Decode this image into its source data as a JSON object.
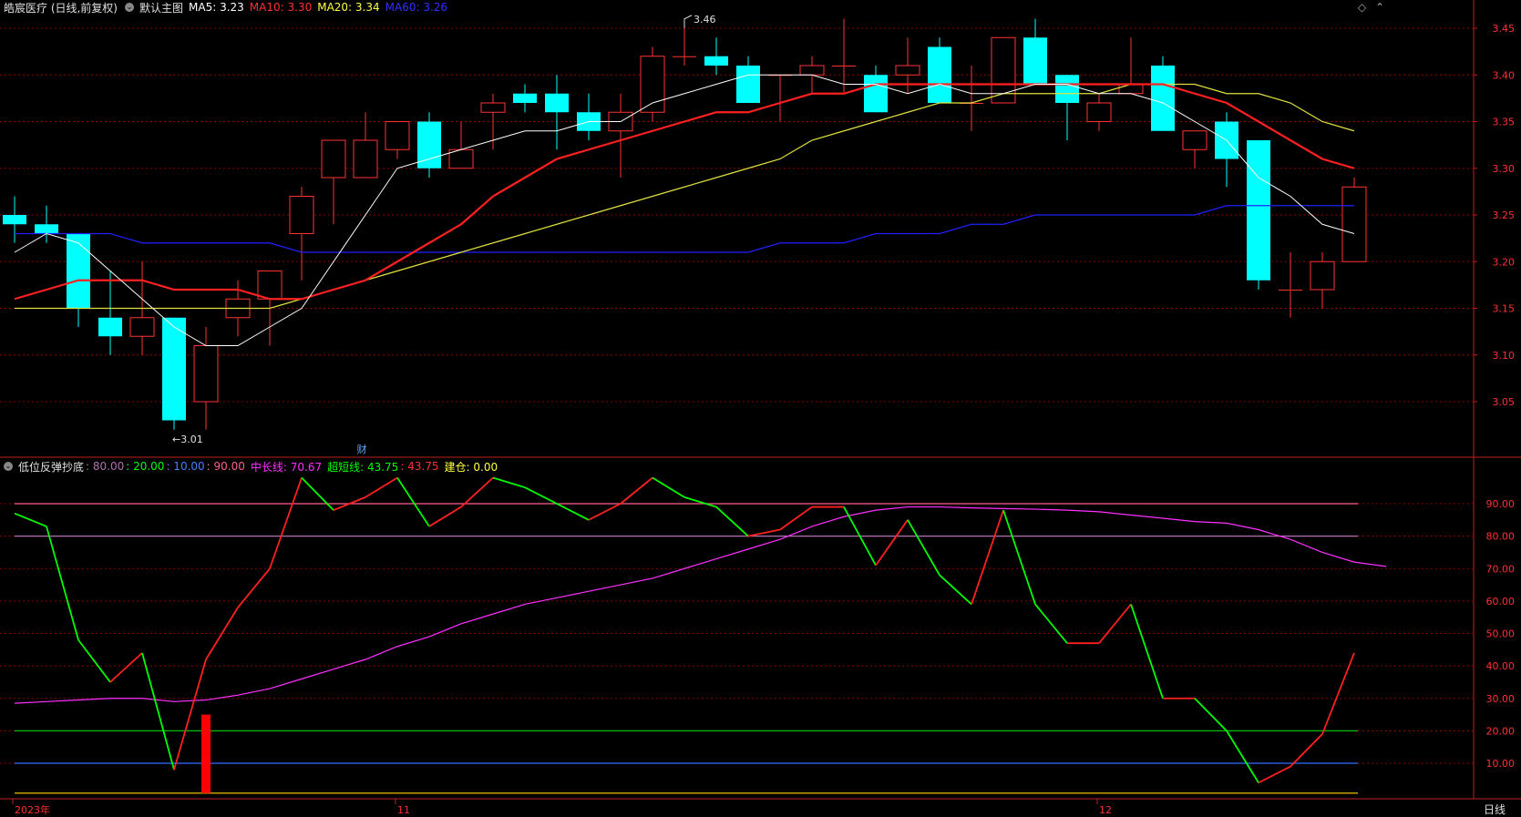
{
  "header_main": {
    "stock": "皓宸医疗 (日线,前复权)",
    "template": "默认主图",
    "ma5": "MA5: 3.23",
    "ma10": "MA10: 3.30",
    "ma20": "MA20: 3.34",
    "ma60": "MA60: 3.26"
  },
  "header_ind": {
    "name": "低位反弹抄底",
    "v80": ": 80.00",
    "v20": ": 20.00",
    "v10": ": 10.00",
    "v90": ": 90.00",
    "mid": "中长线: 70.67",
    "ultra": "超短线: 43.75",
    "ultra2": ": 43.75",
    "build": "建仓: 0.00"
  },
  "colors": {
    "up": "#ff3232",
    "down": "#00ffff",
    "ma5": "#ffffff",
    "ma10": "#ff2020",
    "ma20": "#e0e040",
    "ma60": "#2020ff",
    "grid": "#8b0000",
    "axis": "#c02020",
    "midline": "#ff30ff",
    "ultra_up": "#ff2020",
    "ultra_down": "#00ff00",
    "line90": "#ff6090",
    "line80": "#b070b0",
    "line20": "#00c000",
    "line10": "#3070ff",
    "build": "#c0a000"
  },
  "annotations": {
    "high_label": "3.46",
    "low_label": "←3.01",
    "cai": "财",
    "period": "日线"
  },
  "xaxis": {
    "labels": [
      "2023年",
      "11",
      "12"
    ],
    "label_index": [
      0,
      12,
      34
    ]
  },
  "chart_data": [
    {
      "type": "candlestick",
      "ylim": [
        3.0,
        3.47
      ],
      "yticks": [
        "3.45",
        "3.40",
        "3.35",
        "3.30",
        "3.25",
        "3.20",
        "3.15",
        "3.10",
        "3.05"
      ],
      "candles": [
        [
          3.25,
          3.27,
          3.22,
          3.24
        ],
        [
          3.24,
          3.26,
          3.22,
          3.23
        ],
        [
          3.23,
          3.23,
          3.13,
          3.15
        ],
        [
          3.14,
          3.19,
          3.1,
          3.12
        ],
        [
          3.12,
          3.2,
          3.1,
          3.14
        ],
        [
          3.14,
          3.14,
          3.02,
          3.03
        ],
        [
          3.05,
          3.13,
          3.02,
          3.11
        ],
        [
          3.14,
          3.18,
          3.12,
          3.16
        ],
        [
          3.16,
          3.19,
          3.11,
          3.19
        ],
        [
          3.23,
          3.28,
          3.18,
          3.27
        ],
        [
          3.29,
          3.29,
          3.24,
          3.33
        ],
        [
          3.29,
          3.36,
          3.29,
          3.33
        ],
        [
          3.32,
          3.35,
          3.31,
          3.35
        ],
        [
          3.35,
          3.36,
          3.29,
          3.3
        ],
        [
          3.3,
          3.35,
          3.3,
          3.32
        ],
        [
          3.36,
          3.38,
          3.32,
          3.37
        ],
        [
          3.38,
          3.39,
          3.36,
          3.37
        ],
        [
          3.38,
          3.4,
          3.32,
          3.36
        ],
        [
          3.36,
          3.38,
          3.33,
          3.34
        ],
        [
          3.34,
          3.38,
          3.29,
          3.36
        ],
        [
          3.36,
          3.43,
          3.35,
          3.42
        ],
        [
          3.42,
          3.46,
          3.41,
          3.42
        ],
        [
          3.42,
          3.44,
          3.4,
          3.41
        ],
        [
          3.41,
          3.42,
          3.37,
          3.37
        ],
        [
          3.4,
          3.4,
          3.35,
          3.4
        ],
        [
          3.4,
          3.42,
          3.38,
          3.41
        ],
        [
          3.41,
          3.46,
          3.38,
          3.41
        ],
        [
          3.4,
          3.41,
          3.36,
          3.36
        ],
        [
          3.4,
          3.44,
          3.38,
          3.41
        ],
        [
          3.43,
          3.44,
          3.37,
          3.37
        ],
        [
          3.37,
          3.41,
          3.34,
          3.37
        ],
        [
          3.37,
          3.44,
          3.37,
          3.44
        ],
        [
          3.44,
          3.46,
          3.39,
          3.39
        ],
        [
          3.4,
          3.4,
          3.33,
          3.37
        ],
        [
          3.35,
          3.38,
          3.34,
          3.37
        ],
        [
          3.38,
          3.44,
          3.38,
          3.39
        ],
        [
          3.41,
          3.42,
          3.34,
          3.34
        ],
        [
          3.32,
          3.34,
          3.3,
          3.34
        ],
        [
          3.35,
          3.36,
          3.28,
          3.31
        ],
        [
          3.33,
          3.33,
          3.17,
          3.18
        ],
        [
          3.17,
          3.21,
          3.14,
          3.17
        ],
        [
          3.17,
          3.21,
          3.15,
          3.2
        ],
        [
          3.2,
          3.29,
          3.2,
          3.28
        ]
      ],
      "ma5": [
        3.21,
        3.23,
        3.22,
        3.19,
        3.16,
        3.13,
        3.11,
        3.11,
        3.13,
        3.15,
        3.2,
        3.25,
        3.3,
        3.31,
        3.32,
        3.33,
        3.34,
        3.34,
        3.35,
        3.35,
        3.37,
        3.38,
        3.39,
        3.4,
        3.4,
        3.4,
        3.39,
        3.39,
        3.38,
        3.39,
        3.38,
        3.38,
        3.39,
        3.39,
        3.38,
        3.38,
        3.37,
        3.35,
        3.33,
        3.29,
        3.27,
        3.24,
        3.23
      ],
      "ma10": [
        3.16,
        3.17,
        3.18,
        3.18,
        3.18,
        3.17,
        3.17,
        3.17,
        3.16,
        3.16,
        3.17,
        3.18,
        3.2,
        3.22,
        3.24,
        3.27,
        3.29,
        3.31,
        3.32,
        3.33,
        3.34,
        3.35,
        3.36,
        3.36,
        3.37,
        3.38,
        3.38,
        3.39,
        3.39,
        3.39,
        3.39,
        3.39,
        3.39,
        3.39,
        3.39,
        3.39,
        3.39,
        3.38,
        3.37,
        3.35,
        3.33,
        3.31,
        3.3
      ],
      "ma20": [
        3.15,
        3.15,
        3.15,
        3.15,
        3.15,
        3.15,
        3.15,
        3.15,
        3.15,
        3.16,
        3.17,
        3.18,
        3.19,
        3.2,
        3.21,
        3.22,
        3.23,
        3.24,
        3.25,
        3.26,
        3.27,
        3.28,
        3.29,
        3.3,
        3.31,
        3.33,
        3.34,
        3.35,
        3.36,
        3.37,
        3.37,
        3.38,
        3.38,
        3.38,
        3.38,
        3.39,
        3.39,
        3.39,
        3.38,
        3.38,
        3.37,
        3.35,
        3.34
      ],
      "ma60": [
        3.23,
        3.23,
        3.23,
        3.23,
        3.22,
        3.22,
        3.22,
        3.22,
        3.22,
        3.21,
        3.21,
        3.21,
        3.21,
        3.21,
        3.21,
        3.21,
        3.21,
        3.21,
        3.21,
        3.21,
        3.21,
        3.21,
        3.21,
        3.21,
        3.22,
        3.22,
        3.22,
        3.23,
        3.23,
        3.23,
        3.24,
        3.24,
        3.25,
        3.25,
        3.25,
        3.25,
        3.25,
        3.25,
        3.26,
        3.26,
        3.26,
        3.26,
        3.26
      ]
    },
    {
      "type": "line",
      "ylim": [
        0,
        100
      ],
      "yticks": [
        "90.00",
        "80.00",
        "70.00",
        "60.00",
        "50.00",
        "40.00",
        "30.00",
        "20.00",
        "10.00"
      ],
      "ultra_short": [
        87,
        83,
        48,
        35,
        44,
        8,
        42,
        58,
        70,
        98,
        88,
        92,
        98,
        83,
        89,
        98,
        95,
        90,
        85,
        90,
        98,
        92,
        89,
        80,
        82,
        89,
        89,
        71,
        85,
        68,
        59,
        88,
        59,
        47,
        47,
        59,
        30,
        30,
        20,
        4,
        9,
        19,
        44
      ],
      "mid_long": [
        28.5,
        29,
        29.5,
        30,
        30,
        29,
        29.5,
        31,
        33,
        36,
        39,
        42,
        46,
        49,
        53,
        56,
        59,
        61,
        63,
        65,
        67,
        70,
        73,
        76,
        79,
        83,
        86,
        88,
        89,
        89,
        88.7,
        88.5,
        88.3,
        88,
        87.5,
        86.5,
        85.5,
        84.5,
        84,
        82,
        79,
        75,
        72,
        70.67
      ],
      "build_bar_index": 6,
      "build_bar_value": 25,
      "levels": [
        90,
        80,
        20,
        10
      ]
    }
  ]
}
